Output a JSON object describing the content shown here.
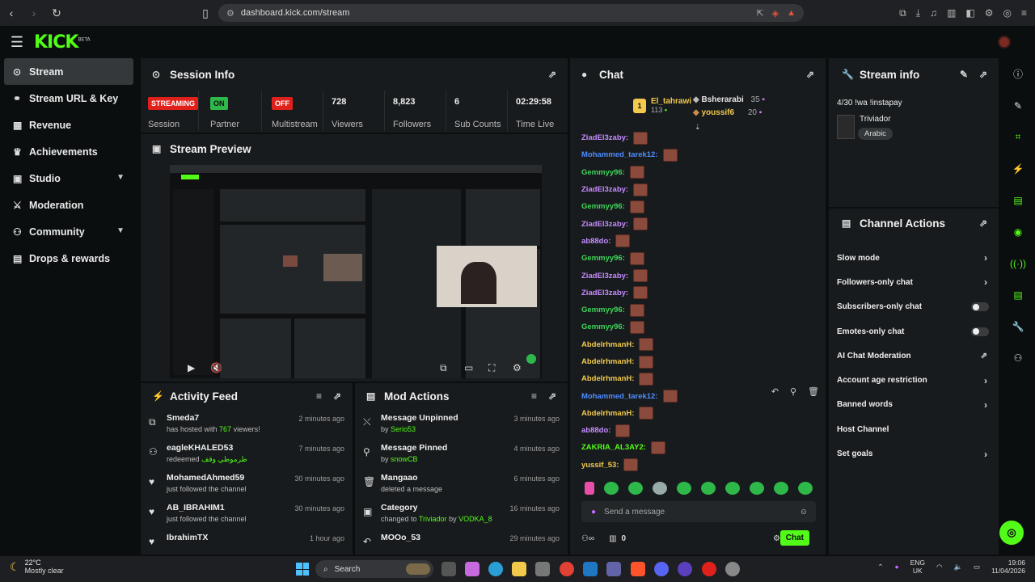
{
  "browser": {
    "url": "dashboard.kick.com/stream",
    "back_icon": "arrow-left-icon",
    "forward_icon": "arrow-right-icon",
    "reload_icon": "reload-icon"
  },
  "brand": {
    "logo": "KICK",
    "beta": "BETA",
    "accent": "#53fc18"
  },
  "sidebar": {
    "items": [
      {
        "label": "Stream",
        "icon": "signal-icon"
      },
      {
        "label": "Stream URL & Key",
        "icon": "link-icon"
      },
      {
        "label": "Revenue",
        "icon": "chart-icon"
      },
      {
        "label": "Achievements",
        "icon": "trophy-icon"
      },
      {
        "label": "Studio",
        "icon": "studio-icon"
      },
      {
        "label": "Moderation",
        "icon": "sword-icon"
      },
      {
        "label": "Community",
        "icon": "community-icon"
      },
      {
        "label": "Drops & rewards",
        "icon": "gift-icon"
      }
    ]
  },
  "session": {
    "title": "Session Info",
    "streaming": "STREAMING",
    "streaming_label": "Session",
    "partner_badge": "ON",
    "partner_label": "Partner",
    "multistream_badge": "OFF",
    "multistream_label": "Multistream",
    "viewers": "728",
    "viewers_label": "Viewers",
    "followers": "8,823",
    "followers_label": "Followers",
    "subs": "6",
    "subs_label": "Sub Counts",
    "time": "02:29:58",
    "time_label": "Time Live"
  },
  "preview": {
    "title": "Stream Preview"
  },
  "activity": {
    "title": "Activity Feed",
    "items": [
      {
        "name": "Smeda7",
        "pre": "has hosted with ",
        "value": "767",
        "post": " viewers!",
        "time": "2 minutes ago",
        "icon": "host-icon"
      },
      {
        "name": "eagleKHALED53",
        "pre": "redeemed ",
        "value": "طرموطي وقف",
        "post": "",
        "time": "7 minutes ago",
        "icon": "redeem-icon"
      },
      {
        "name": "MohamedAhmed59",
        "pre": "just followed the channel",
        "value": "",
        "post": "",
        "time": "30 minutes ago",
        "icon": "heart-icon"
      },
      {
        "name": "AB_IBRAHIM1",
        "pre": "just followed the channel",
        "value": "",
        "post": "",
        "time": "30 minutes ago",
        "icon": "heart-icon"
      },
      {
        "name": "IbrahimTX",
        "pre": "",
        "value": "",
        "post": "",
        "time": "1 hour ago",
        "icon": "heart-icon"
      }
    ]
  },
  "mod": {
    "title": "Mod Actions",
    "items": [
      {
        "title": "Message Unpinned",
        "pre": "by ",
        "value": "Serio53",
        "mid": "",
        "value2": "",
        "time": "3 minutes ago",
        "icon": "unpin-icon"
      },
      {
        "title": "Message Pinned",
        "pre": "by ",
        "value": "snowCB",
        "mid": "",
        "value2": "",
        "time": "4 minutes ago",
        "icon": "pin-icon"
      },
      {
        "title": "Mangaao",
        "pre": "deleted a message",
        "value": "",
        "mid": "",
        "value2": "",
        "time": "6 minutes ago",
        "icon": "trash-icon"
      },
      {
        "title": "Category",
        "pre": "changed to ",
        "value": "Triviador",
        "mid": " by ",
        "value2": "VODKA_8",
        "time": "16 minutes ago",
        "icon": "category-icon"
      },
      {
        "title": "MOOo_53",
        "pre": "",
        "value": "",
        "mid": "",
        "value2": "",
        "time": "29 minutes ago",
        "icon": "undo-icon"
      }
    ]
  },
  "chat": {
    "title": "Chat",
    "leaders": {
      "first": {
        "rank": "1",
        "name": "El_tahrawi",
        "count": "113"
      },
      "second": {
        "name": "Bsherarabi",
        "count": "35"
      },
      "third": {
        "name": "youssif6",
        "count": "20"
      }
    },
    "messages": [
      {
        "user": "ZiadEl3zaby:",
        "color": "#c58cff"
      },
      {
        "user": "Mohammed_tarek12:",
        "color": "#4f8cff"
      },
      {
        "user": "Gemmyy96:",
        "color": "#3fd35a"
      },
      {
        "user": "ZiadEl3zaby:",
        "color": "#c58cff"
      },
      {
        "user": "Gemmyy96:",
        "color": "#3fd35a"
      },
      {
        "user": "ZiadEl3zaby:",
        "color": "#c58cff"
      },
      {
        "user": "ab88do:",
        "color": "#c58cff"
      },
      {
        "user": "Gemmyy96:",
        "color": "#3fd35a"
      },
      {
        "user": "ZiadEl3zaby:",
        "color": "#c58cff"
      },
      {
        "user": "ZiadEl3zaby:",
        "color": "#c58cff"
      },
      {
        "user": "Gemmyy96:",
        "color": "#3fd35a"
      },
      {
        "user": "Gemmyy96:",
        "color": "#3fd35a"
      },
      {
        "user": "AbdelrhmanH:",
        "color": "#f2c94c"
      },
      {
        "user": "AbdelrhmanH:",
        "color": "#f2c94c"
      },
      {
        "user": "AbdelrhmanH:",
        "color": "#f2c94c"
      },
      {
        "user": "Mohammed_tarek12:",
        "color": "#4f8cff"
      },
      {
        "user": "AbdelrhmanH:",
        "color": "#f2c94c"
      },
      {
        "user": "ab88do:",
        "color": "#c58cff"
      },
      {
        "user": "ZAKRIA_AL3AY2:",
        "color": "#53fc18"
      },
      {
        "user": "yussif_53:",
        "color": "#f2c94c"
      }
    ],
    "input_placeholder": "Send a message",
    "points": "0",
    "send_label": "Chat"
  },
  "stream_info": {
    "title": "Stream info",
    "stream_title": "4/30 !wa !instapay",
    "category": "Triviador",
    "language": "Arabic"
  },
  "channel_actions": {
    "title": "Channel Actions",
    "items": [
      {
        "label": "Slow mode",
        "control": "chevron"
      },
      {
        "label": "Followers-only chat",
        "control": "chevron"
      },
      {
        "label": "Subscribers-only chat",
        "control": "toggle"
      },
      {
        "label": "Emotes-only chat",
        "control": "toggle"
      },
      {
        "label": "AI Chat Moderation",
        "control": "external"
      },
      {
        "label": "Account age restriction",
        "control": "chevron"
      },
      {
        "label": "Banned words",
        "control": "chevron"
      },
      {
        "label": "Host Channel",
        "control": "none"
      },
      {
        "label": "Set goals",
        "control": "chevron"
      }
    ]
  },
  "taskbar": {
    "temp": "22°C",
    "weather": "Mostly clear",
    "search": "Search",
    "lang1": "ENG",
    "lang2": "UK",
    "time": "19:06",
    "date": "11/04/2026"
  }
}
